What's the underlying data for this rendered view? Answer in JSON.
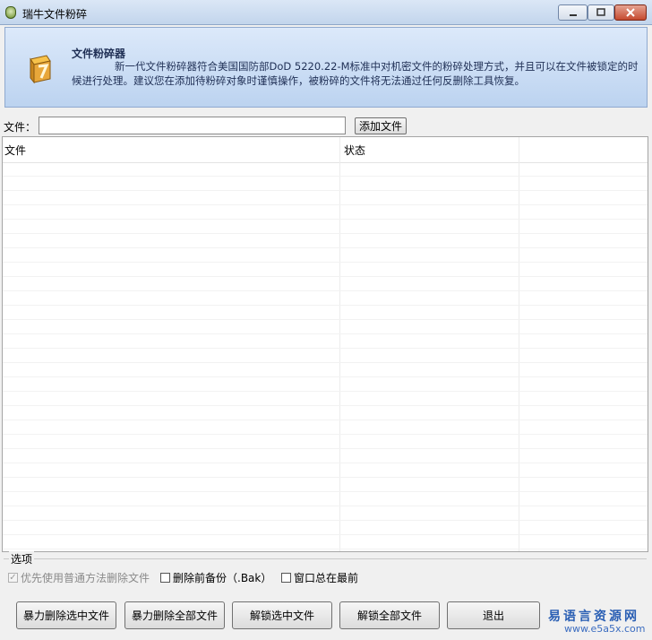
{
  "window": {
    "title": "瑞牛文件粉碎",
    "minimize_icon": "minimize-icon",
    "maximize_icon": "maximize-icon",
    "close_icon": "close-icon"
  },
  "banner": {
    "title": "文件粉碎器",
    "description": "新一代文件粉碎器符合美国国防部DoD 5220.22-M标准中对机密文件的粉碎处理方式，并且可以在文件被锁定的时候进行处理。建议您在添加待粉碎对象时谨慎操作，被粉碎的文件将无法通过任何反删除工具恢复。",
    "icon": "file-shredder-icon"
  },
  "file_input": {
    "label": "文件：",
    "value": "",
    "add_button": "添加文件"
  },
  "file_list": {
    "columns": [
      "文件",
      "状态",
      ""
    ],
    "rows": []
  },
  "options": {
    "group_title": "选项",
    "items": [
      {
        "label": "优先使用普通方法删除文件",
        "checked": true,
        "enabled": false
      },
      {
        "label": "删除前备份（.Bak）",
        "checked": false,
        "enabled": true
      },
      {
        "label": "窗口总在最前",
        "checked": false,
        "enabled": true
      }
    ]
  },
  "buttons": {
    "force_delete_selected": "暴力删除选中文件",
    "force_delete_all": "暴力删除全部文件",
    "unlock_selected": "解锁选中文件",
    "unlock_all": "解锁全部文件",
    "exit": "退出"
  },
  "watermark": {
    "text": "易语言资源网",
    "url": "www.e5a5x.com"
  }
}
